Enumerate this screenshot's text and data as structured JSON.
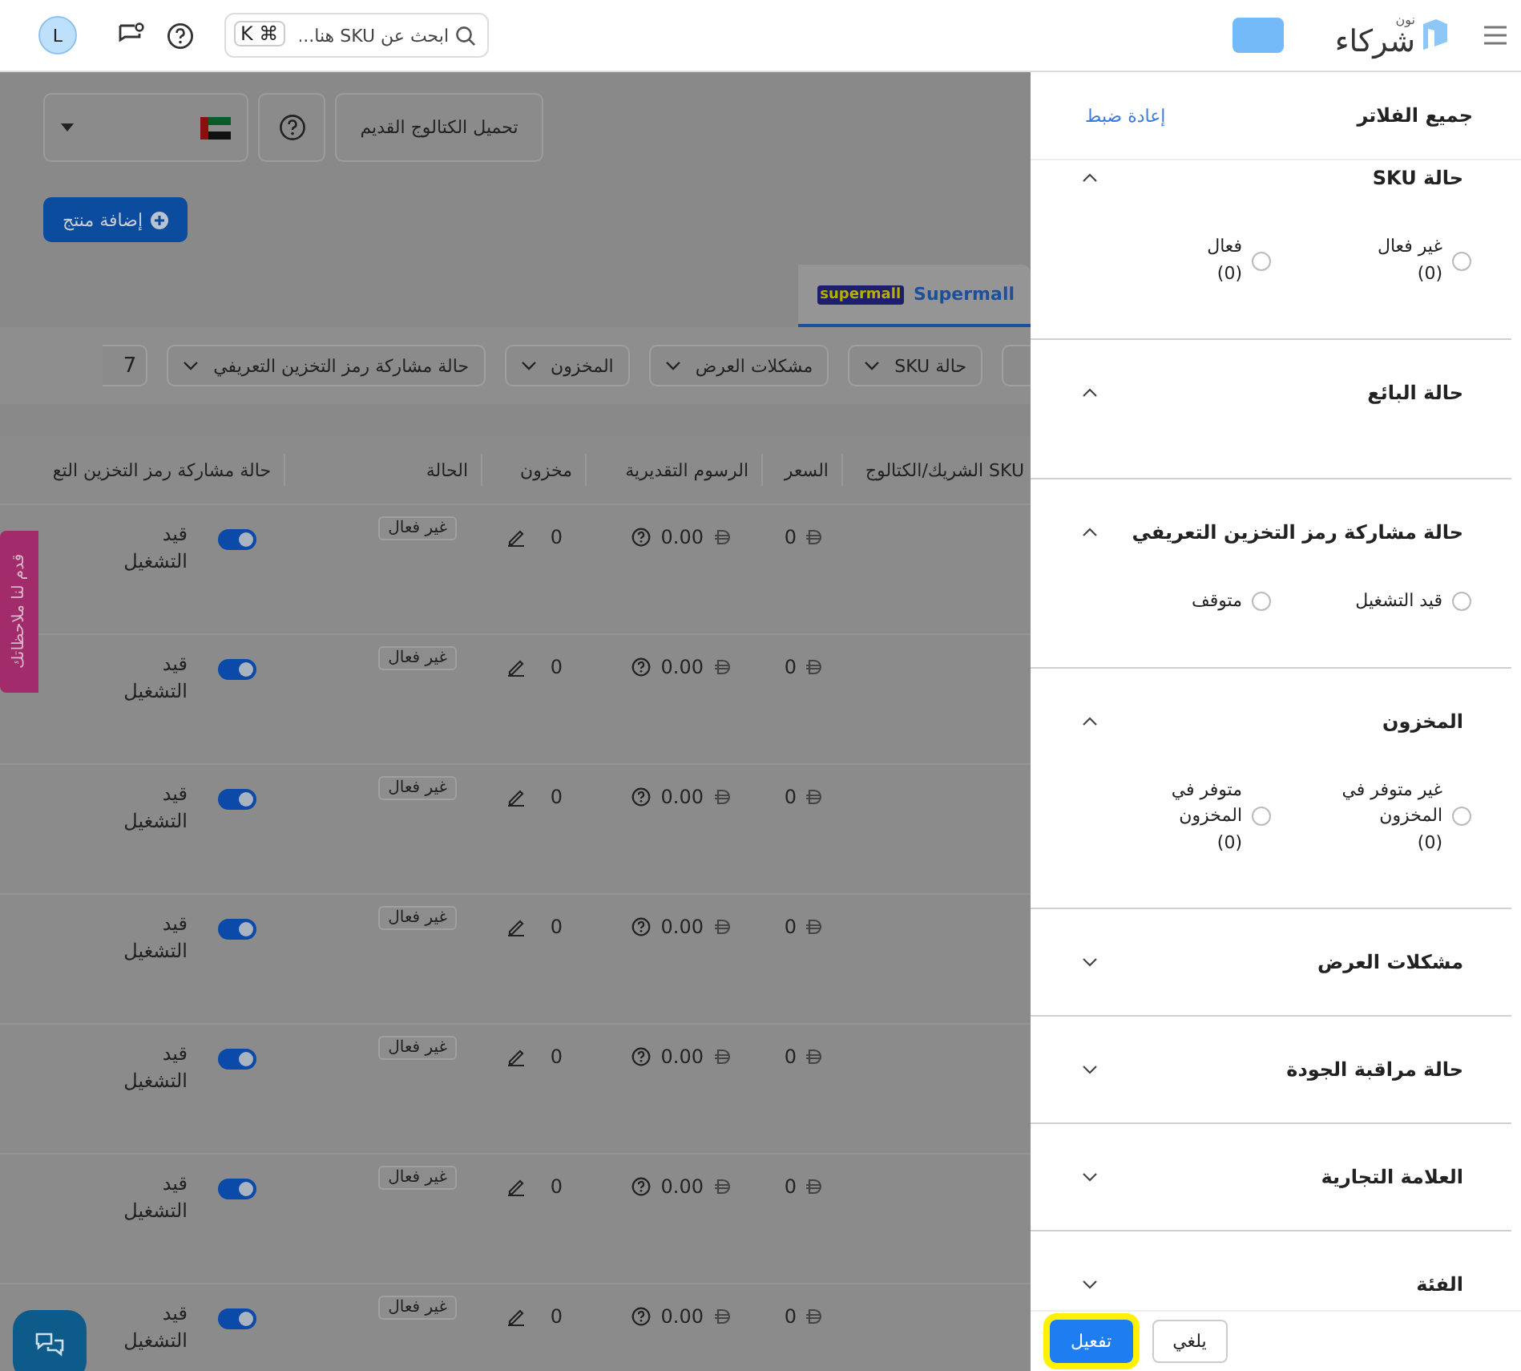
{
  "top_bar": {
    "logo_text": "شركاء",
    "logo_subtext": "نون",
    "search": {
      "placeholder": "ابحث عن SKU هنا...",
      "shortcut_symbol": "⌘",
      "shortcut_key": "K"
    },
    "avatar": "L"
  },
  "toolbar": {
    "download_button": "تحميل الكتالوج القديم",
    "add_product_button": "إضافة منتج"
  },
  "store_tabs": [
    {
      "label": "Supermall",
      "logo_text": "supermall",
      "selected": true
    }
  ],
  "filters": [
    "حالة SKU",
    "مشكلات العرض",
    "المخزون",
    "حالة مشاركة رمز التخزين التعريفي",
    "7"
  ],
  "table": {
    "columns": [
      "SKU الشريك/الكتالوج",
      "السعر",
      "الرسوم التقديرية",
      "مخزون",
      "الحالة",
      "حالة مشاركة رمز التخزين التع"
    ],
    "rows": [
      {
        "sharing_on": true,
        "sharing_label": "قيد التشغيل",
        "status": "غير فعال",
        "stock": "0",
        "fees": "0.00",
        "price": "0"
      },
      {
        "sharing_on": true,
        "sharing_label": "قيد التشغيل",
        "status": "غير فعال",
        "stock": "0",
        "fees": "0.00",
        "price": "0"
      },
      {
        "sharing_on": true,
        "sharing_label": "قيد التشغيل",
        "status": "غير فعال",
        "stock": "0",
        "fees": "0.00",
        "price": "0"
      },
      {
        "sharing_on": true,
        "sharing_label": "قيد التشغيل",
        "status": "غير فعال",
        "stock": "0",
        "fees": "0.00",
        "price": "0"
      },
      {
        "sharing_on": true,
        "sharing_label": "قيد التشغيل",
        "status": "غير فعال",
        "stock": "0",
        "fees": "0.00",
        "price": "0"
      },
      {
        "sharing_on": true,
        "sharing_label": "قيد التشغيل",
        "status": "غير فعال",
        "stock": "0",
        "fees": "0.00",
        "price": "0"
      },
      {
        "sharing_on": true,
        "sharing_label": "قيد التشغيل",
        "status": "غير فعال",
        "stock": "0",
        "fees": "0.00",
        "price": "0"
      }
    ]
  },
  "feedback_tab": "قدم لنا ملاحظاتك",
  "drawer": {
    "title": "جميع الفلاتر",
    "reset": "إعادة ضبط",
    "sections": [
      {
        "title": "حالة SKU",
        "expanded": true,
        "options": [
          {
            "label": "غير فعال",
            "count": "(0)",
            "selected": false
          },
          {
            "label": "فعال",
            "count": "(0)",
            "selected": false
          }
        ]
      },
      {
        "title": "حالة البائع",
        "expanded": true
      },
      {
        "title": "حالة مشاركة رمز التخزين التعريفي",
        "expanded": true,
        "options": [
          {
            "label": "قيد التشغيل",
            "selected": false
          },
          {
            "label": "متوقف",
            "selected": false
          }
        ]
      },
      {
        "title": "المخزون",
        "expanded": true,
        "options": [
          {
            "label": "غير متوفر في المخزون",
            "count": "(0)",
            "selected": false
          },
          {
            "label": "متوفر في المخزون",
            "count": "(0)",
            "selected": false
          }
        ]
      },
      {
        "title": "مشكلات العرض",
        "expanded": false
      },
      {
        "title": "حالة مراقبة الجودة",
        "expanded": false
      },
      {
        "title": "العلامة التجارية",
        "expanded": false
      },
      {
        "title": "الفئة",
        "expanded": false
      }
    ],
    "buttons": [
      {
        "label": "يلغي",
        "kind": "secondary",
        "highlighted": false
      },
      {
        "label": "تفعيل",
        "kind": "primary",
        "highlighted": true
      }
    ]
  }
}
